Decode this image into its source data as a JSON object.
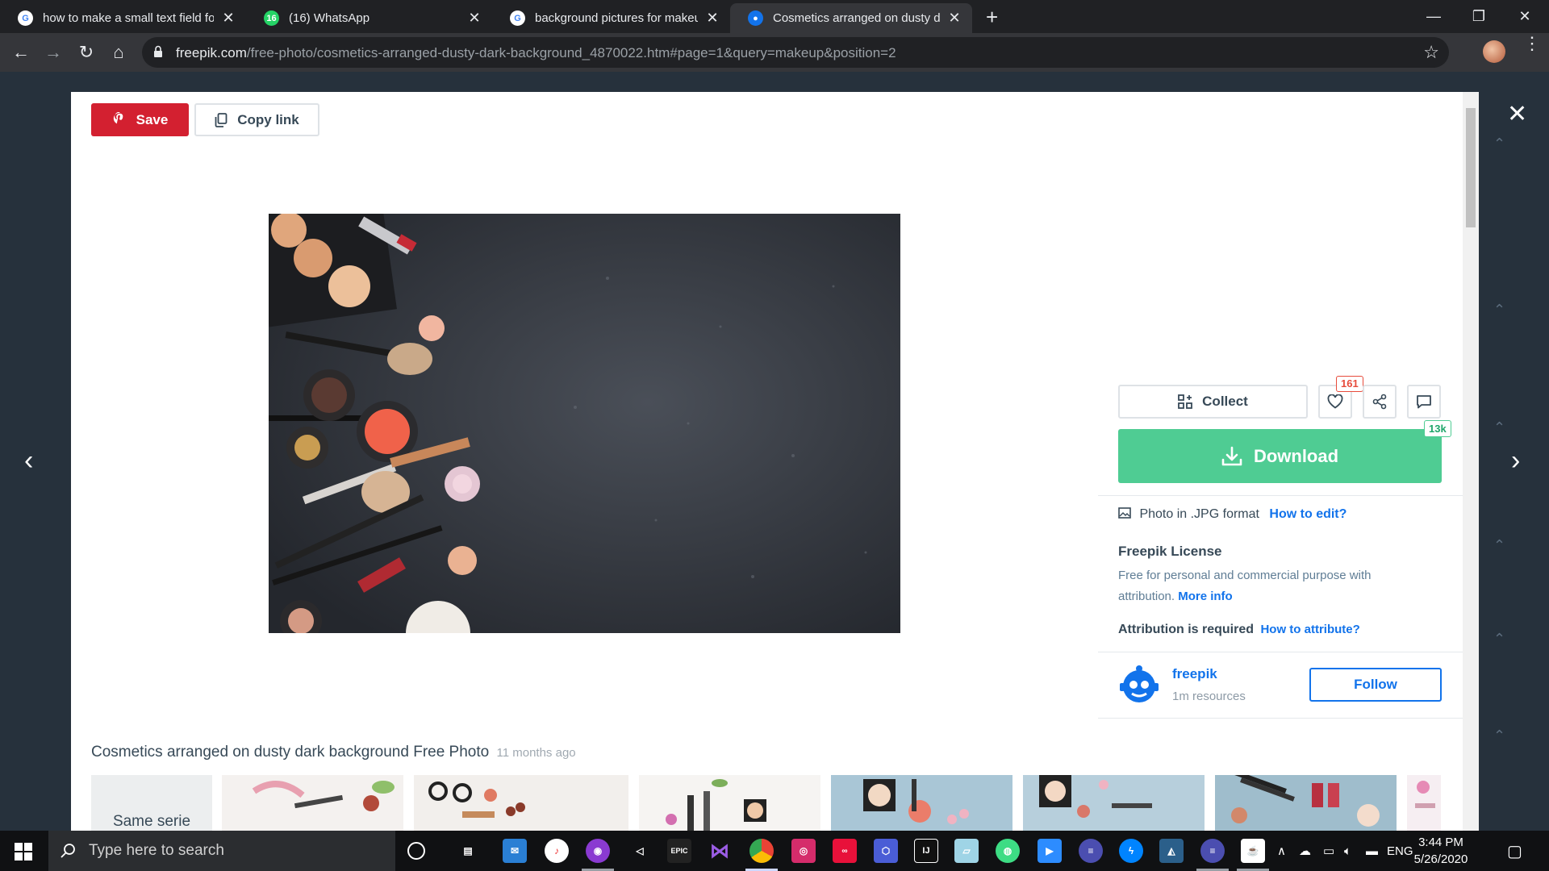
{
  "browser": {
    "tabs": [
      {
        "title": "how to make a small text field fo",
        "favicon": "google-icon"
      },
      {
        "title": "(16) WhatsApp",
        "favicon": "whatsapp-icon",
        "badge": "16"
      },
      {
        "title": "background pictures for makeup",
        "favicon": "google-icon"
      },
      {
        "title": "Cosmetics arranged on dusty dar",
        "favicon": "freepik-icon"
      }
    ],
    "new_tab_label": "+",
    "url_domain": "freepik.com",
    "url_path": "/free-photo/cosmetics-arranged-dusty-dark-background_4870022.htm#page=1&query=makeup&position=2"
  },
  "toolbar": {
    "save_label": "Save",
    "copy_link_label": "Copy link"
  },
  "photo": {
    "title": "Cosmetics arranged on dusty dark background Free Photo",
    "age": "11 months ago"
  },
  "related": {
    "same_serie_label": "Same serie"
  },
  "panel": {
    "collect_label": "Collect",
    "likes_count": "161",
    "download_label": "Download",
    "download_count": "13k",
    "format_text": "Photo in .JPG format",
    "how_to_edit": "How to edit?",
    "license_title": "Freepik License",
    "license_text": "Free for personal and commercial purpose with attribution.",
    "more_info": "More info",
    "attribution_text": "Attribution is required",
    "how_to_attribute": "How to attribute?",
    "author_name": "freepik",
    "author_resources": "1m resources",
    "follow_label": "Follow"
  },
  "taskbar": {
    "search_placeholder": "Type here to search",
    "language": "ENG",
    "time": "3:44 PM",
    "date": "5/26/2020"
  },
  "colors": {
    "save_red": "#d32030",
    "download_green": "#4fcc93",
    "link_blue": "#1273eb"
  }
}
